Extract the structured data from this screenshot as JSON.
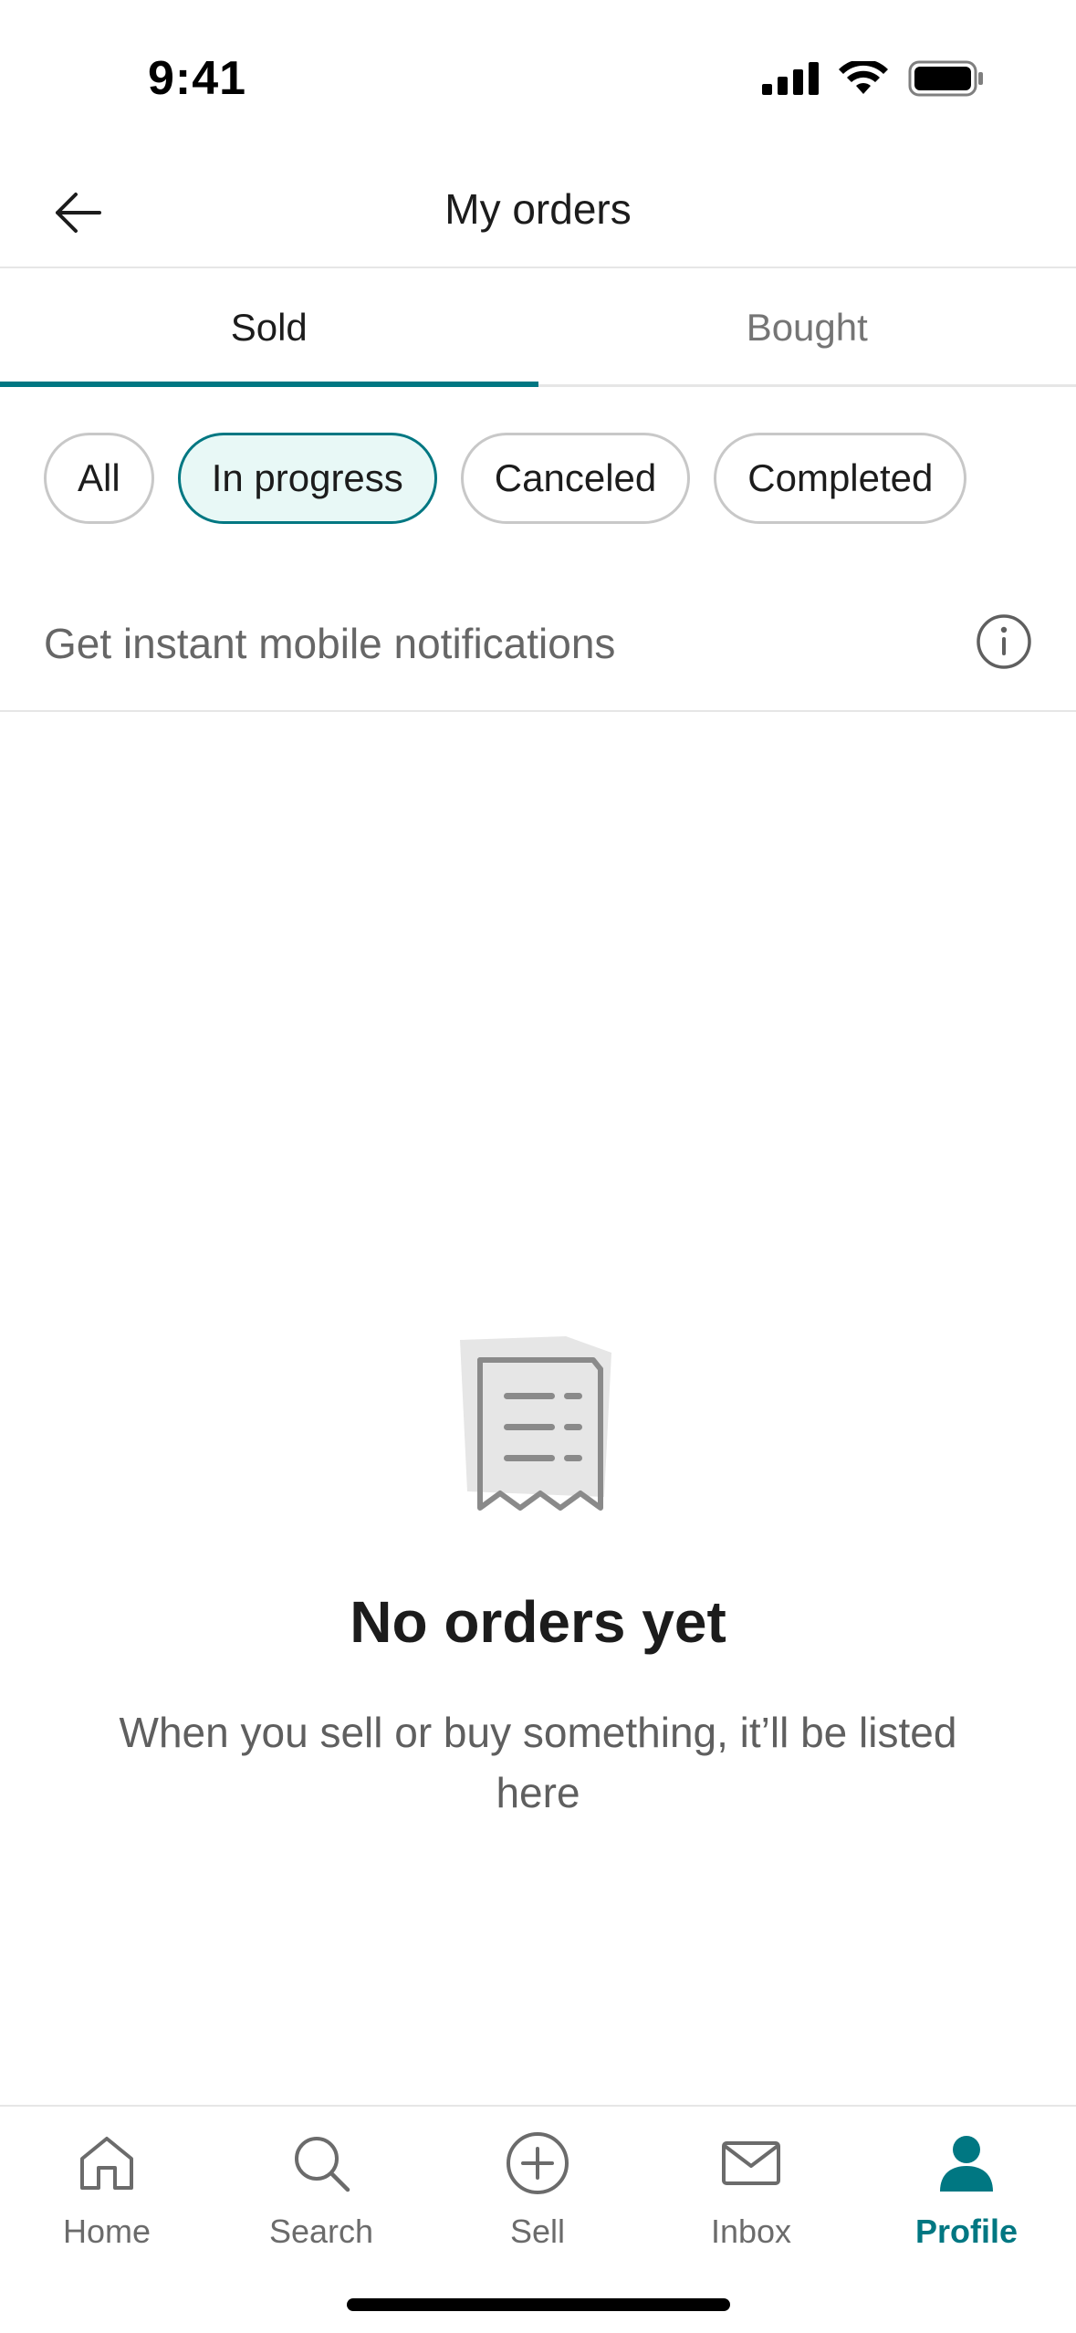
{
  "status_bar": {
    "time": "9:41"
  },
  "header": {
    "title": "My orders",
    "back_icon": "arrow-left-icon"
  },
  "tabs": [
    {
      "label": "Sold",
      "active": true
    },
    {
      "label": "Bought",
      "active": false
    }
  ],
  "filters": [
    {
      "label": "All",
      "selected": false
    },
    {
      "label": "In progress",
      "selected": true
    },
    {
      "label": "Canceled",
      "selected": false
    },
    {
      "label": "Completed",
      "selected": false
    }
  ],
  "notifications": {
    "text": "Get instant mobile notifications",
    "icon": "info-icon"
  },
  "empty_state": {
    "icon": "receipt-icon",
    "title": "No orders yet",
    "description": "When you sell or buy something, it’ll be listed here"
  },
  "bottom_nav": [
    {
      "label": "Home",
      "icon": "home-icon",
      "active": false
    },
    {
      "label": "Search",
      "icon": "search-icon",
      "active": false
    },
    {
      "label": "Sell",
      "icon": "plus-circle-icon",
      "active": false
    },
    {
      "label": "Inbox",
      "icon": "mail-icon",
      "active": false
    },
    {
      "label": "Profile",
      "icon": "person-icon",
      "active": true
    }
  ],
  "colors": {
    "accent": "#007782",
    "chip_selected_bg": "#e8f8f6",
    "divider": "#e6e6e6",
    "muted_text": "#666666"
  }
}
